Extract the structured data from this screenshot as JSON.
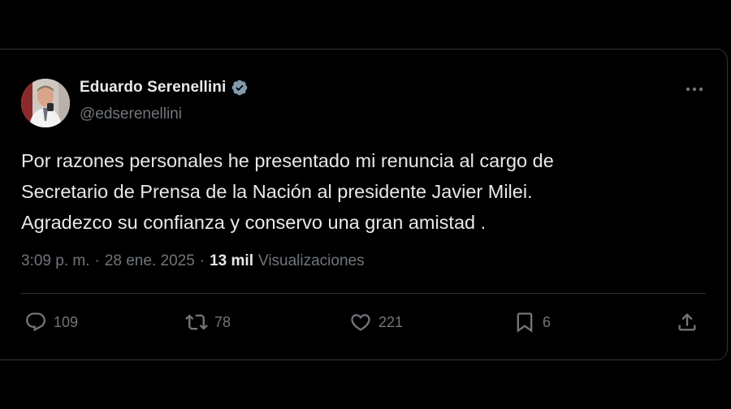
{
  "author": {
    "display_name": "Eduardo Serenellini",
    "handle": "@edserenellini",
    "verified_icon": "verified-badge-icon"
  },
  "tweet": {
    "text": "Por razones personales he presentado mi renuncia al cargo de\nSecretario de Prensa de la Nación al presidente Javier Milei.\nAgradezco su confianza y conservo una gran amistad .",
    "time": "3:09 p. m.",
    "separator": "·",
    "date": "28 ene. 2025",
    "views_count": "13 mil",
    "views_label": "Visualizaciones"
  },
  "actions": {
    "replies": "109",
    "reposts": "78",
    "likes": "221",
    "bookmarks": "6"
  },
  "colors": {
    "background": "#000000",
    "text_primary": "#e7e9ea",
    "text_secondary": "#71767b",
    "border": "#2f3336",
    "verified": "#829aab"
  }
}
